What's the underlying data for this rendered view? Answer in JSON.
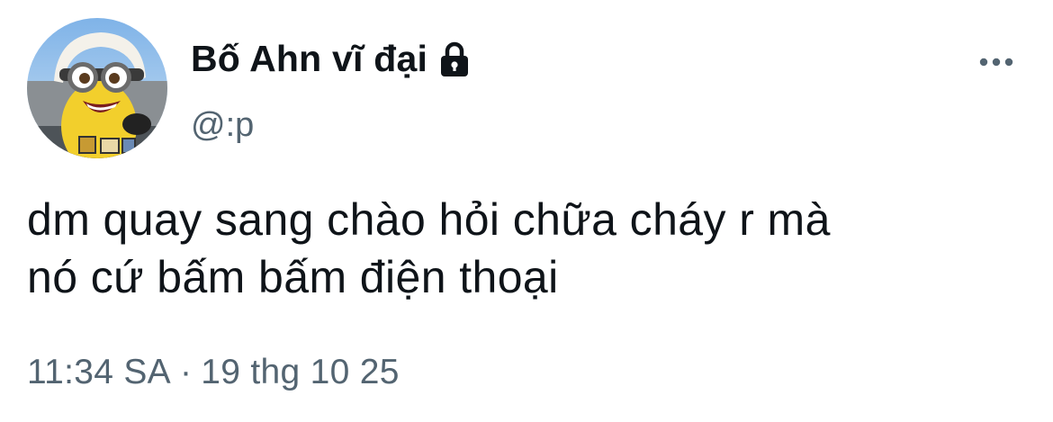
{
  "author": {
    "display_name": "Bố Ahn vĩ đại",
    "handle": "@:p",
    "avatar_icon": "minion-avatar",
    "protected_icon": "lock-icon"
  },
  "actions": {
    "more_icon": "more-horizontal-icon"
  },
  "tweet": {
    "text": "dm quay sang chào hỏi chữa cháy r mà\nnó cứ bấm bấm điện thoại"
  },
  "meta": {
    "time": "11:34 SA",
    "separator": "·",
    "date": "19 thg 10 25"
  },
  "colors": {
    "text_primary": "#0f1419",
    "text_secondary": "#536471",
    "background": "#ffffff"
  }
}
